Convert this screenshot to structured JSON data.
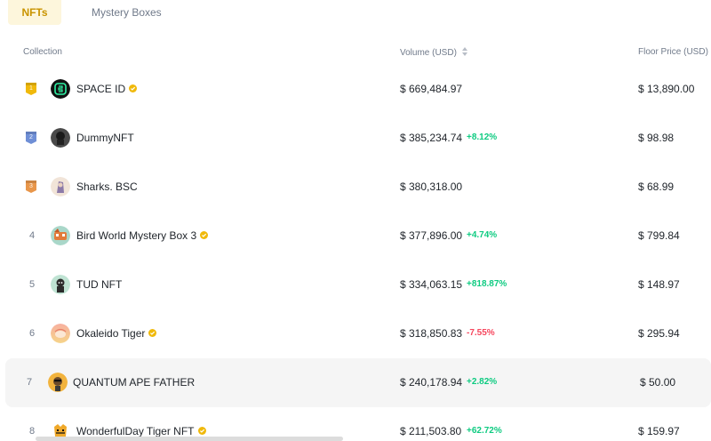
{
  "tabs": [
    {
      "label": "NFTs",
      "active": true
    },
    {
      "label": "Mystery Boxes",
      "active": false
    }
  ],
  "columns": {
    "collection": "Collection",
    "volume": "Volume (USD)",
    "floor": "Floor Price (USD)"
  },
  "colors": {
    "accent": "#c99400",
    "positive": "#0ecb81",
    "negative": "#f6465d",
    "gold_badge": "#f0b90b",
    "silver_badge": "#6f8fd6",
    "bronze_badge": "#e8964a"
  },
  "rows": [
    {
      "rank": "1",
      "badge": "gold",
      "icon": "space-id-avatar",
      "name": "SPACE ID",
      "verified": true,
      "volume": "$ 669,484.97",
      "change": "",
      "change_dir": "",
      "floor": "$ 13,890.00"
    },
    {
      "rank": "2",
      "badge": "silver",
      "icon": "dummynft-avatar",
      "name": "DummyNFT",
      "verified": false,
      "volume": "$ 385,234.74",
      "change": "+8.12%",
      "change_dir": "up",
      "floor": "$ 98.98"
    },
    {
      "rank": "3",
      "badge": "bronze",
      "icon": "sharks-avatar",
      "name": "Sharks. BSC",
      "verified": false,
      "volume": "$ 380,318.00",
      "change": "",
      "change_dir": "",
      "floor": "$ 68.99"
    },
    {
      "rank": "4",
      "badge": "",
      "icon": "bird-world-avatar",
      "name": "Bird World Mystery Box 3",
      "verified": true,
      "volume": "$ 377,896.00",
      "change": "+4.74%",
      "change_dir": "up",
      "floor": "$ 799.84"
    },
    {
      "rank": "5",
      "badge": "",
      "icon": "tud-nft-avatar",
      "name": "TUD NFT",
      "verified": false,
      "volume": "$ 334,063.15",
      "change": "+818.87%",
      "change_dir": "up",
      "floor": "$ 148.97"
    },
    {
      "rank": "6",
      "badge": "",
      "icon": "okaleido-tiger-avatar",
      "name": "Okaleido Tiger",
      "verified": true,
      "volume": "$ 318,850.83",
      "change": "-7.55%",
      "change_dir": "down",
      "floor": "$ 295.94"
    },
    {
      "rank": "7",
      "badge": "",
      "icon": "quantum-ape-avatar",
      "name": "QUANTUM APE FATHER",
      "verified": false,
      "volume": "$ 240,178.94",
      "change": "+2.82%",
      "change_dir": "up",
      "floor": "$ 50.00"
    },
    {
      "rank": "8",
      "badge": "",
      "icon": "wonderfulday-tiger-avatar",
      "name": "WonderfulDay Tiger NFT",
      "verified": true,
      "volume": "$ 211,503.80",
      "change": "+62.72%",
      "change_dir": "up",
      "floor": "$ 159.97"
    }
  ]
}
